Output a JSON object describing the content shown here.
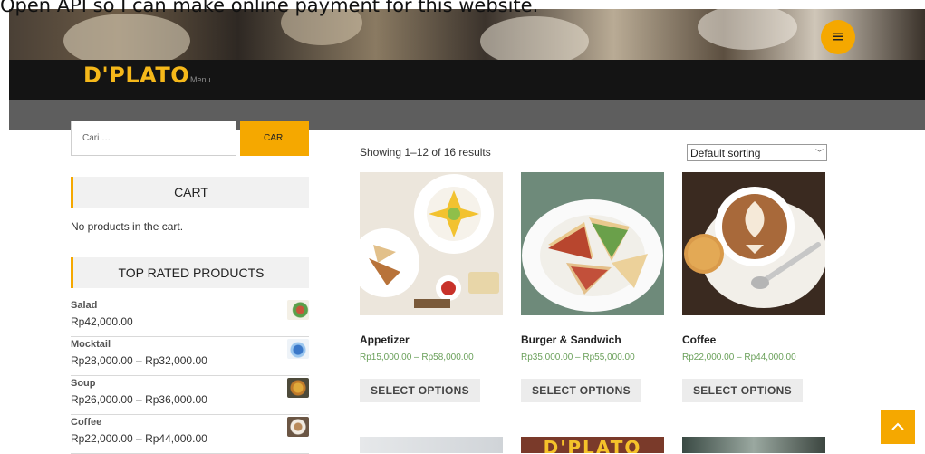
{
  "caption": "Open API so I can make online payment for this website.",
  "header": {
    "menu_icon": "hamburger-icon",
    "logo_text": "D'PLATO",
    "logo_sub": "Menu"
  },
  "search": {
    "placeholder": "Cari …",
    "button_label": "CARI"
  },
  "cart": {
    "title": "CART",
    "empty_text": "No products in the cart."
  },
  "top_rated": {
    "title": "TOP RATED PRODUCTS",
    "items": [
      {
        "name": "Salad",
        "price": "Rp42,000.00"
      },
      {
        "name": "Mocktail",
        "price": "Rp28,000.00 – Rp32,000.00"
      },
      {
        "name": "Soup",
        "price": "Rp26,000.00 – Rp36,000.00"
      },
      {
        "name": "Coffee",
        "price": "Rp22,000.00 – Rp44,000.00"
      }
    ]
  },
  "shop": {
    "result_count": "Showing 1–12 of 16 results",
    "sorting": "Default sorting",
    "products": [
      {
        "title": "Appetizer",
        "price": "Rp15,000.00 – Rp58,000.00",
        "button": "SELECT OPTIONS"
      },
      {
        "title": "Burger & Sandwich",
        "price": "Rp35,000.00 – Rp55,000.00",
        "button": "SELECT OPTIONS"
      },
      {
        "title": "Coffee",
        "price": "Rp22,000.00 – Rp44,000.00",
        "button": "SELECT OPTIONS"
      }
    ],
    "next_row_banner": "D'PLATO"
  },
  "colors": {
    "accent": "#f5a800",
    "navbar": "#141414",
    "price_green": "#6aa05a"
  },
  "icons": {
    "scroll_top": "chevron-up-icon",
    "sort_chevron": "chevron-down-icon"
  }
}
